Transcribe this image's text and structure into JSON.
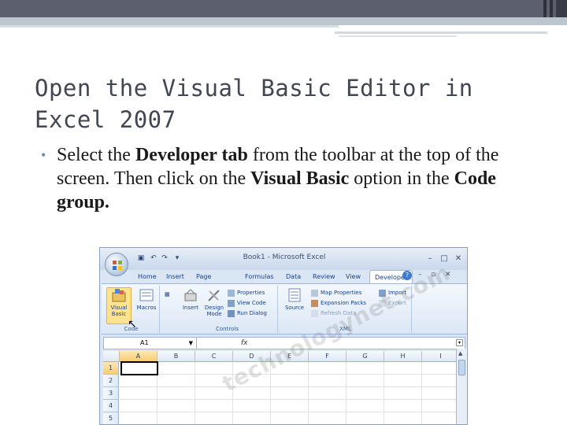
{
  "slide": {
    "title": "Open the Visual Basic Editor in Excel 2007",
    "bullet_mark": "•",
    "bullet_parts": [
      {
        "text": "Select the ",
        "bold": false
      },
      {
        "text": "Developer tab",
        "bold": true
      },
      {
        "text": " from the toolbar at the top of the screen. Then click on the ",
        "bold": false
      },
      {
        "text": "Visual Basic",
        "bold": true
      },
      {
        "text": " option in the ",
        "bold": false
      },
      {
        "text": "Code group.",
        "bold": true
      }
    ]
  },
  "excel": {
    "window_title": "Book1 - Microsoft Excel",
    "window_buttons": [
      "–",
      "□",
      "✕"
    ],
    "quick_access": [
      "save-icon",
      "undo-icon",
      "redo-icon",
      "customize-icon"
    ],
    "tabs": [
      "Home",
      "Insert",
      "Page Layout",
      "Formulas",
      "Data",
      "Review",
      "View",
      "Developer"
    ],
    "active_tab": "Developer",
    "ribbon": {
      "code": {
        "label": "Code",
        "visual_basic": "Visual Basic",
        "macros": "Macros"
      },
      "controls": {
        "label": "Controls",
        "insert": "Insert",
        "design_mode": "Design Mode",
        "properties": "Properties",
        "view_code": "View Code",
        "run_dialog": "Run Dialog"
      },
      "xml": {
        "label": "XML",
        "source": "Source",
        "map_properties": "Map Properties",
        "expansion_packs": "Expansion Packs",
        "refresh_data": "Refresh Data",
        "import": "Import",
        "export": "Export"
      }
    },
    "name_box": "A1",
    "fx_label": "fx",
    "columns": [
      "A",
      "B",
      "C",
      "D",
      "E",
      "F",
      "G",
      "H",
      "I"
    ],
    "rows": [
      "1",
      "2",
      "3",
      "4",
      "5"
    ],
    "selected_cell": "A1",
    "watermark": "technologynet.com",
    "colors": {
      "accent": "#15428b",
      "ribbon": "#dbe7f5",
      "highlight": "#ffe38f"
    }
  }
}
